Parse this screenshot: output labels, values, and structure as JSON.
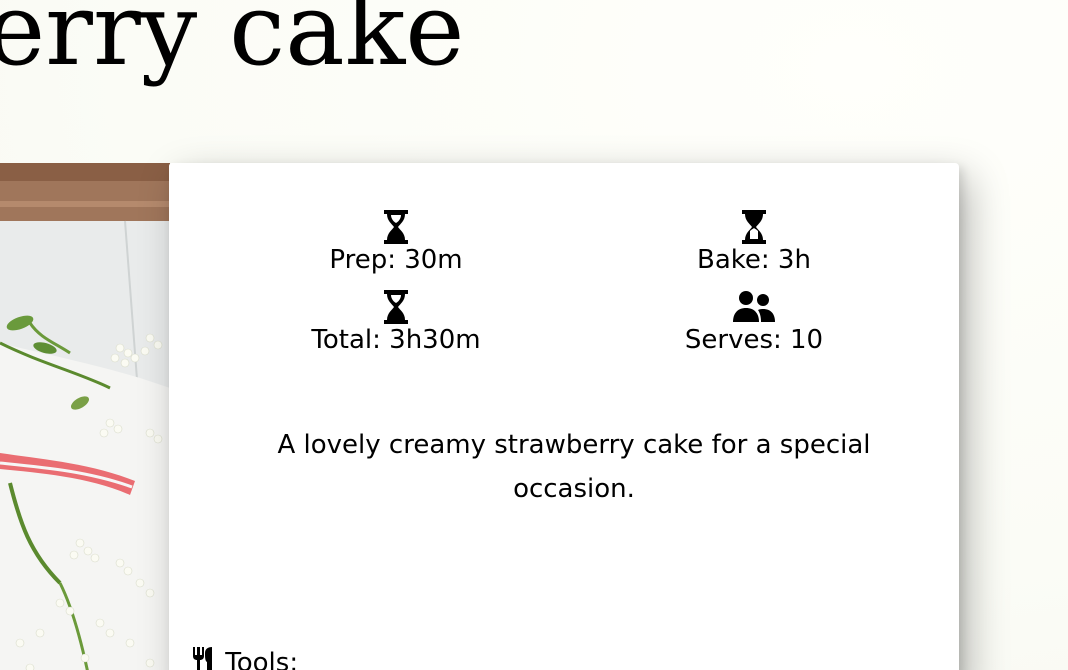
{
  "recipe": {
    "title": "erry cake",
    "description": "A lovely creamy strawberry cake for a special occasion.",
    "stats": {
      "prep": {
        "icon": "hourglass-end-icon",
        "label": "Prep: 30m"
      },
      "bake": {
        "icon": "hourglass-half-icon",
        "label": "Bake: 3h"
      },
      "total": {
        "icon": "hourglass-end-icon",
        "label": "Total: 3h30m"
      },
      "serves": {
        "icon": "user-group-icon",
        "label": "Serves: 10"
      }
    },
    "tools": {
      "icon": "utensils-icon",
      "label": "Tools:"
    }
  },
  "colors": {
    "page_bg": "#fefffa",
    "card_bg": "#ffffff",
    "text": "#000000"
  }
}
